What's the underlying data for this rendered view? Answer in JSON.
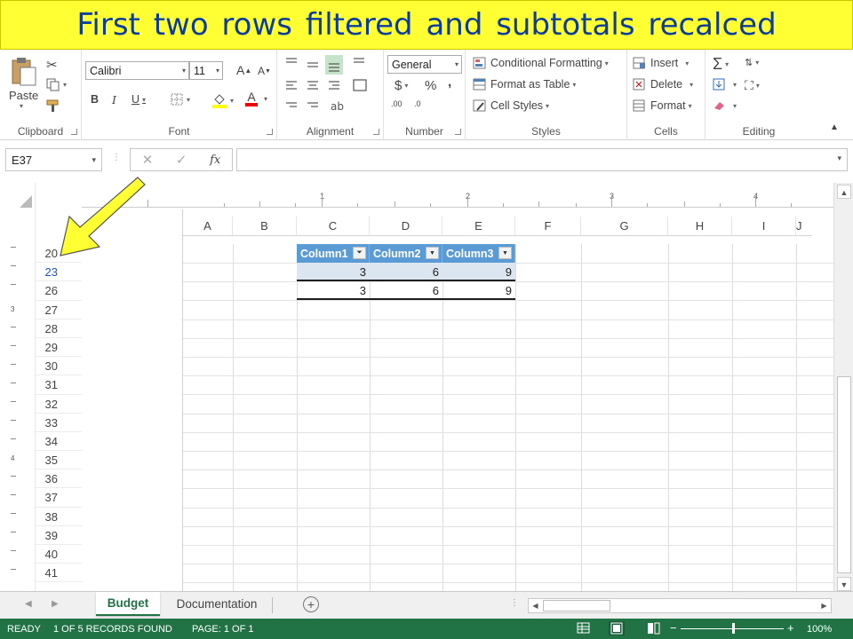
{
  "banner": {
    "title": "First two rows filtered and subtotals recalced"
  },
  "ribbon": {
    "clipboard": {
      "paste_label": "Paste",
      "group_label": "Clipboard"
    },
    "font": {
      "name": "Calibri",
      "size": "11",
      "group_label": "Font",
      "bold": "B",
      "italic": "I",
      "underline": "U",
      "grow": "A",
      "shrink": "A",
      "font_color": "A"
    },
    "alignment": {
      "group_label": "Alignment"
    },
    "number": {
      "format": "General",
      "currency": "$",
      "percent": "%",
      "comma": ",",
      "inc_decimal": ".00",
      "dec_decimal": ".0",
      "group_label": "Number"
    },
    "styles": {
      "conditional_formatting": "Conditional Formatting",
      "format_as_table": "Format as Table",
      "cell_styles": "Cell Styles",
      "group_label": "Styles"
    },
    "cells": {
      "insert": "Insert",
      "delete": "Delete",
      "format": "Format",
      "group_label": "Cells"
    },
    "editing": {
      "sum": "Σ",
      "group_label": "Editing"
    }
  },
  "formula_bar": {
    "name_box": "E37",
    "cancel": "✕",
    "enter": "✓",
    "fx": "fx",
    "formula": ""
  },
  "ruler": {
    "marks": [
      "1",
      "2",
      "3",
      "4"
    ]
  },
  "columns": [
    "A",
    "B",
    "C",
    "D",
    "E",
    "F",
    "G",
    "H",
    "I",
    "J"
  ],
  "rows": [
    "20",
    "23",
    "26",
    "27",
    "28",
    "29",
    "30",
    "31",
    "32",
    "33",
    "34",
    "35",
    "36",
    "37",
    "38",
    "39",
    "40",
    "41"
  ],
  "outline_levels": [
    "3",
    "4"
  ],
  "table": {
    "headers": [
      "Column1",
      "Column2",
      "Column3"
    ],
    "rows": [
      [
        "3",
        "6",
        "9"
      ],
      [
        "3",
        "6",
        "9"
      ]
    ]
  },
  "sheet_tabs": {
    "active": "Budget",
    "other": "Documentation",
    "add": "+"
  },
  "status_bar": {
    "ready": "READY",
    "records": "1 OF 5 RECORDS FOUND",
    "page": "PAGE: 1 OF 1",
    "zoom": "100%",
    "zoom_minus": "−",
    "zoom_plus": "+"
  },
  "colors": {
    "banner_bg": "#ffff33",
    "banner_text": "#0c3d9c",
    "status_bg": "#217346",
    "table_header": "#5b9bd5",
    "table_band": "#dce6f1",
    "arrow": "#ffff33"
  }
}
